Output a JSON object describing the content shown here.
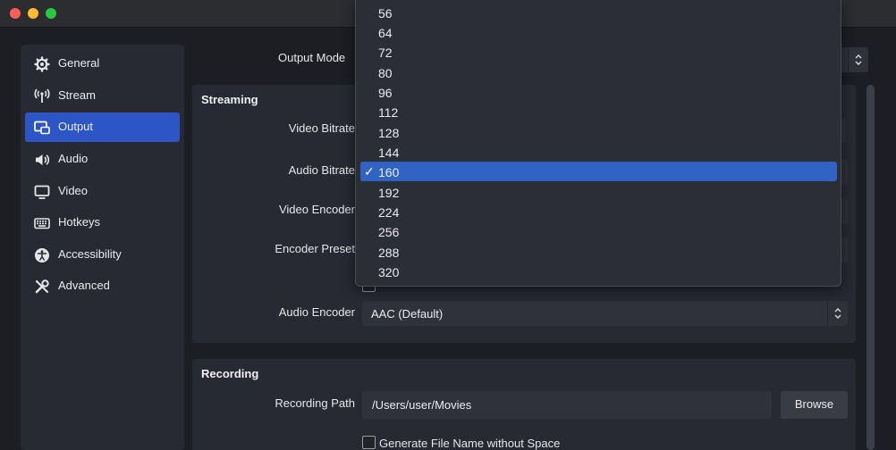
{
  "sidebar": {
    "items": [
      {
        "label": "General",
        "icon": "gear-icon"
      },
      {
        "label": "Stream",
        "icon": "antenna-icon"
      },
      {
        "label": "Output",
        "icon": "output-icon",
        "active": true
      },
      {
        "label": "Audio",
        "icon": "speaker-icon"
      },
      {
        "label": "Video",
        "icon": "monitor-icon"
      },
      {
        "label": "Hotkeys",
        "icon": "keyboard-icon"
      },
      {
        "label": "Accessibility",
        "icon": "accessibility-icon"
      },
      {
        "label": "Advanced",
        "icon": "tools-icon"
      }
    ]
  },
  "output_mode": {
    "label": "Output Mode"
  },
  "streaming": {
    "title": "Streaming",
    "video_bitrate_label": "Video Bitrate",
    "audio_bitrate_label": "Audio Bitrate",
    "video_encoder_label": "Video Encoder",
    "encoder_preset_label": "Encoder Preset",
    "audio_encoder_label": "Audio Encoder",
    "audio_encoder_value": "AAC (Default)"
  },
  "recording": {
    "title": "Recording",
    "path_label": "Recording Path",
    "path_value": "/Users/user/Movies",
    "browse_label": "Browse",
    "gen_filename_label": "Generate File Name without Space"
  },
  "bitrate_dropdown": {
    "options": [
      "56",
      "64",
      "72",
      "80",
      "96",
      "112",
      "128",
      "144",
      "160",
      "192",
      "224",
      "256",
      "288",
      "320"
    ],
    "selected": "160",
    "check_glyph": "✓"
  },
  "colors": {
    "accent": "#2c55c6",
    "selected_option": "#2f63c4",
    "panel": "#272a33",
    "background": "#1c1e24"
  }
}
